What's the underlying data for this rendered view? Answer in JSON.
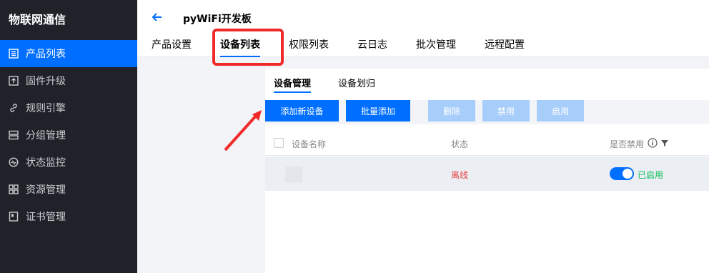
{
  "sidebar": {
    "brand": "物联网通信",
    "items": [
      {
        "label": "产品列表",
        "icon": "list-icon",
        "active": true
      },
      {
        "label": "固件升级",
        "icon": "upload-icon"
      },
      {
        "label": "规则引擎",
        "icon": "link-icon"
      },
      {
        "label": "分组管理",
        "icon": "server-icon"
      },
      {
        "label": "状态监控",
        "icon": "monitor-icon"
      },
      {
        "label": "资源管理",
        "icon": "grid-icon"
      },
      {
        "label": "证书管理",
        "icon": "certificate-icon"
      }
    ]
  },
  "header": {
    "back_icon": "arrow-left-icon",
    "title": "pyWiFi开发板",
    "tabs": [
      "产品设置",
      "设备列表",
      "权限列表",
      "云日志",
      "批次管理",
      "远程配置"
    ],
    "active_tab": "设备列表"
  },
  "device_tabs": [
    "设备管理",
    "设备划归"
  ],
  "toolbar": {
    "add_new": "添加新设备",
    "batch_add": "批量添加",
    "delete": "删除",
    "disable": "禁用",
    "enable": "启用"
  },
  "table": {
    "columns": [
      "设备名称",
      "状态",
      "是否禁用"
    ],
    "rows": [
      {
        "name": "",
        "status": "离线",
        "enabled_text": "已启用"
      }
    ]
  },
  "colors": {
    "accent": "#006eff",
    "sidebar_bg": "#1f2329",
    "offline": "#e54545",
    "enabled": "#0abf5b",
    "highlight": "#f02a2a"
  }
}
